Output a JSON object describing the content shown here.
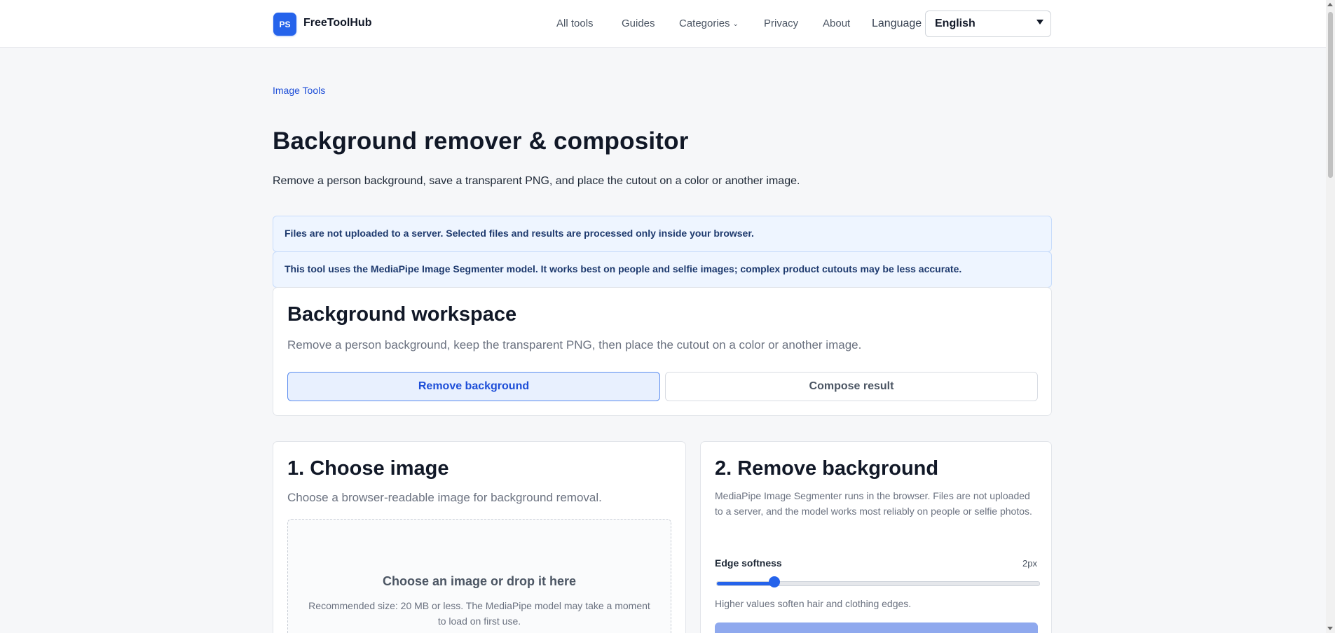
{
  "header": {
    "logo_badge": "PS",
    "brand": "FreeToolHub",
    "nav": [
      {
        "label": "All tools"
      },
      {
        "label": "Guides"
      },
      {
        "label": "Categories"
      },
      {
        "label": "Privacy"
      },
      {
        "label": "About"
      }
    ],
    "language_label": "Language",
    "language_value": "English"
  },
  "breadcrumb": "Image Tools",
  "page_title": "Background remover & compositor",
  "page_subtitle": "Remove a person background, save a transparent PNG, and place the cutout on a color or another image.",
  "notices": [
    "Files are not uploaded to a server. Selected files and results are processed only inside your browser.",
    "This tool uses the MediaPipe Image Segmenter model. It works best on people and selfie images; complex product cutouts may be less accurate."
  ],
  "workspace": {
    "title": "Background workspace",
    "description": "Remove a person background, keep the transparent PNG, then place the cutout on a color or another image.",
    "modes": [
      {
        "label": "Remove background",
        "active": true
      },
      {
        "label": "Compose result",
        "active": false
      }
    ]
  },
  "choose_image": {
    "title": "1. Choose image",
    "description": "Choose a browser-readable image for background removal.",
    "drop_title": "Choose an image or drop it here",
    "drop_hint": "Recommended size: 20 MB or less. The MediaPipe model may take a moment to load on first use."
  },
  "remove_background": {
    "title": "2. Remove background",
    "description": "MediaPipe Image Segmenter runs in the browser. Files are not uploaded to a server, and the model works most reliably on people or selfie photos.",
    "slider_label": "Edge softness",
    "slider_value_text": "2px",
    "slider_fraction": 0.18,
    "slider_help": "Higher values soften hair and clothing edges."
  },
  "colors": {
    "accent": "#2563eb",
    "notice_bg": "#eef5ff",
    "run_button_disabled": "#8fa9ee"
  }
}
